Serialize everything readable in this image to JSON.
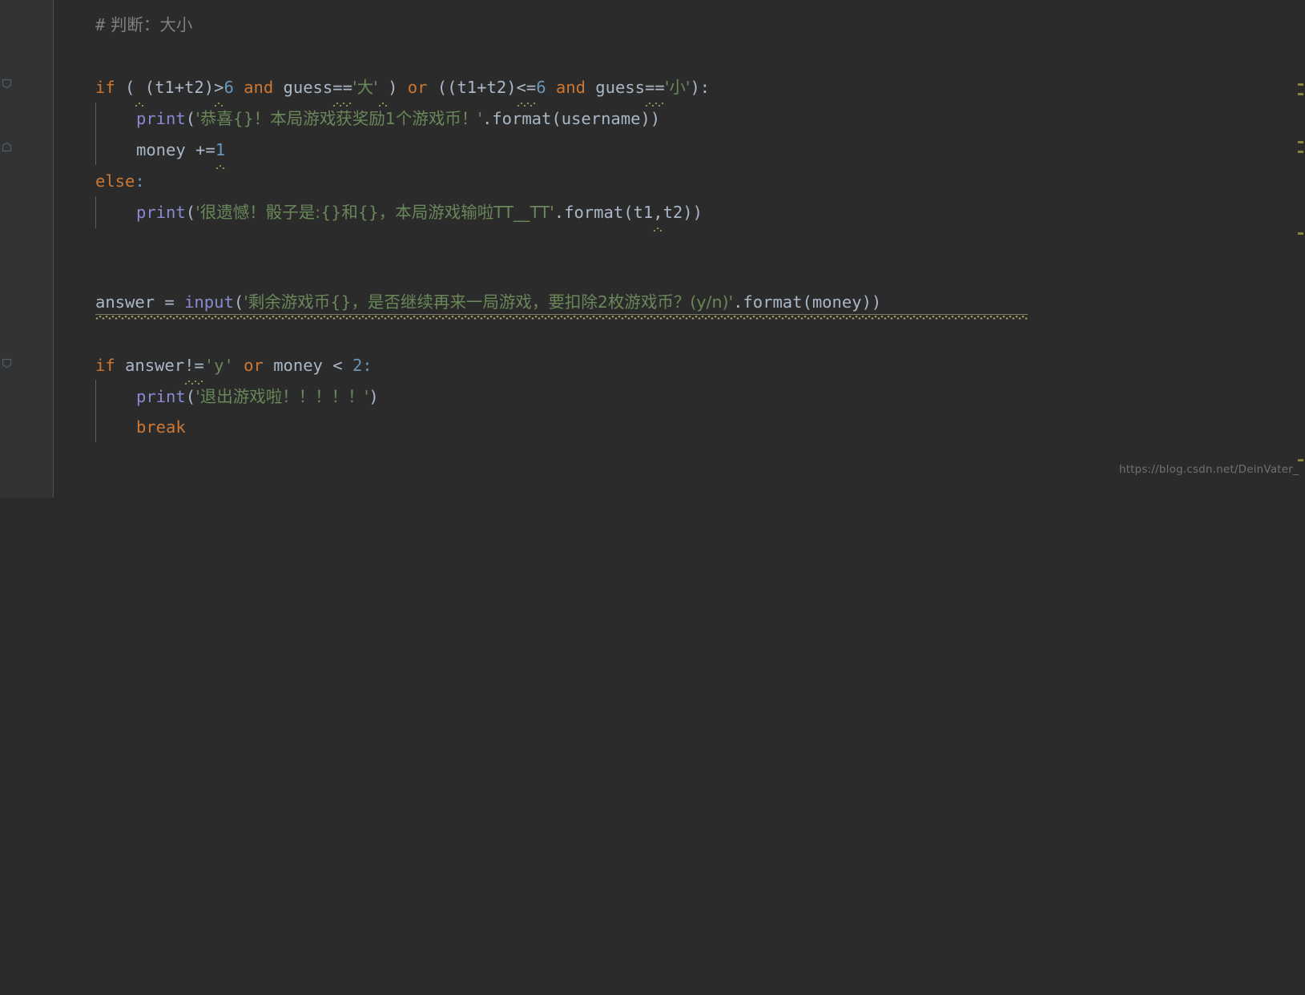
{
  "editor": {
    "background_color": "#2b2b2b",
    "gutter_color": "#313335",
    "language": "python"
  },
  "colors": {
    "comment": "#808080",
    "keyword": "#cc7832",
    "function": "#8a8ad4",
    "string": "#6a8759",
    "number": "#6897bb",
    "identifier": "#a9b7c6",
    "warning_squiggle": "#a9a14b",
    "watermark": "#6e7073"
  },
  "code": {
    "comment_line": {
      "hash": "#",
      "text": " 判断：大小"
    },
    "if_line_1": {
      "kw_if": "if",
      "open_paren": " (",
      "space_warn": " ",
      "cond1_open": "(",
      "t1": "t1",
      "plus": "+",
      "t2": "t2",
      "close1": ")",
      "gt": ">",
      "six": "6",
      "and": " and ",
      "guess": "guess",
      "eqeq": "==",
      "str_da": "'大'",
      "space2": " ",
      "close2": ")",
      "or": " or ",
      "cond2_open": "((",
      "t1b": "t1",
      "plusb": "+",
      "t2b": "t2",
      "close1b": ")",
      "lte": "<=",
      "sixb": "6",
      "andb": " and ",
      "guessb": "guess",
      "eqeqb": "==",
      "str_xiao": "'小'",
      "tail": "):"
    },
    "print_win": {
      "fn": "print",
      "open": "(",
      "string": "'恭喜{}！本局游戏获奖励1个游戏币！'",
      "dot_format": ".format",
      "open2": "(",
      "arg": "username",
      "close": "))"
    },
    "money_line": {
      "ident": "money",
      "op": " +=",
      "value": "1"
    },
    "else_line": {
      "kw": "else",
      "colon": ":"
    },
    "print_lose": {
      "fn": "print",
      "open": "(",
      "string": "'很遗憾！骰子是:{}和{}，本局游戏输啦TT__TT'",
      "dot_format": ".format",
      "open2": "(",
      "arg1": "t1",
      "comma": ",",
      "arg2": "t2",
      "close": "))"
    },
    "answer_line": {
      "ident": "answer",
      "eq": " = ",
      "fn": "input",
      "open": "(",
      "string": "'剩余游戏币{}，是否继续再来一局游戏，要扣除2枚游戏币？(y/n)'",
      "dot_format": ".format",
      "open2": "(",
      "arg": "money",
      "close": "))"
    },
    "if_line_2": {
      "kw_if": "if ",
      "ident": "answer",
      "neq": "!=",
      "str_y": "'y'",
      "or": " or ",
      "money": "money",
      "lt": " < ",
      "two": "2",
      "colon": ":"
    },
    "print_exit": {
      "fn": "print",
      "open": "(",
      "string": "'退出游戏啦！！！！！'",
      "close": ")"
    },
    "break_line": {
      "kw": "break"
    }
  },
  "watermark": {
    "text": "https://blog.csdn.net/DeinVater_"
  }
}
